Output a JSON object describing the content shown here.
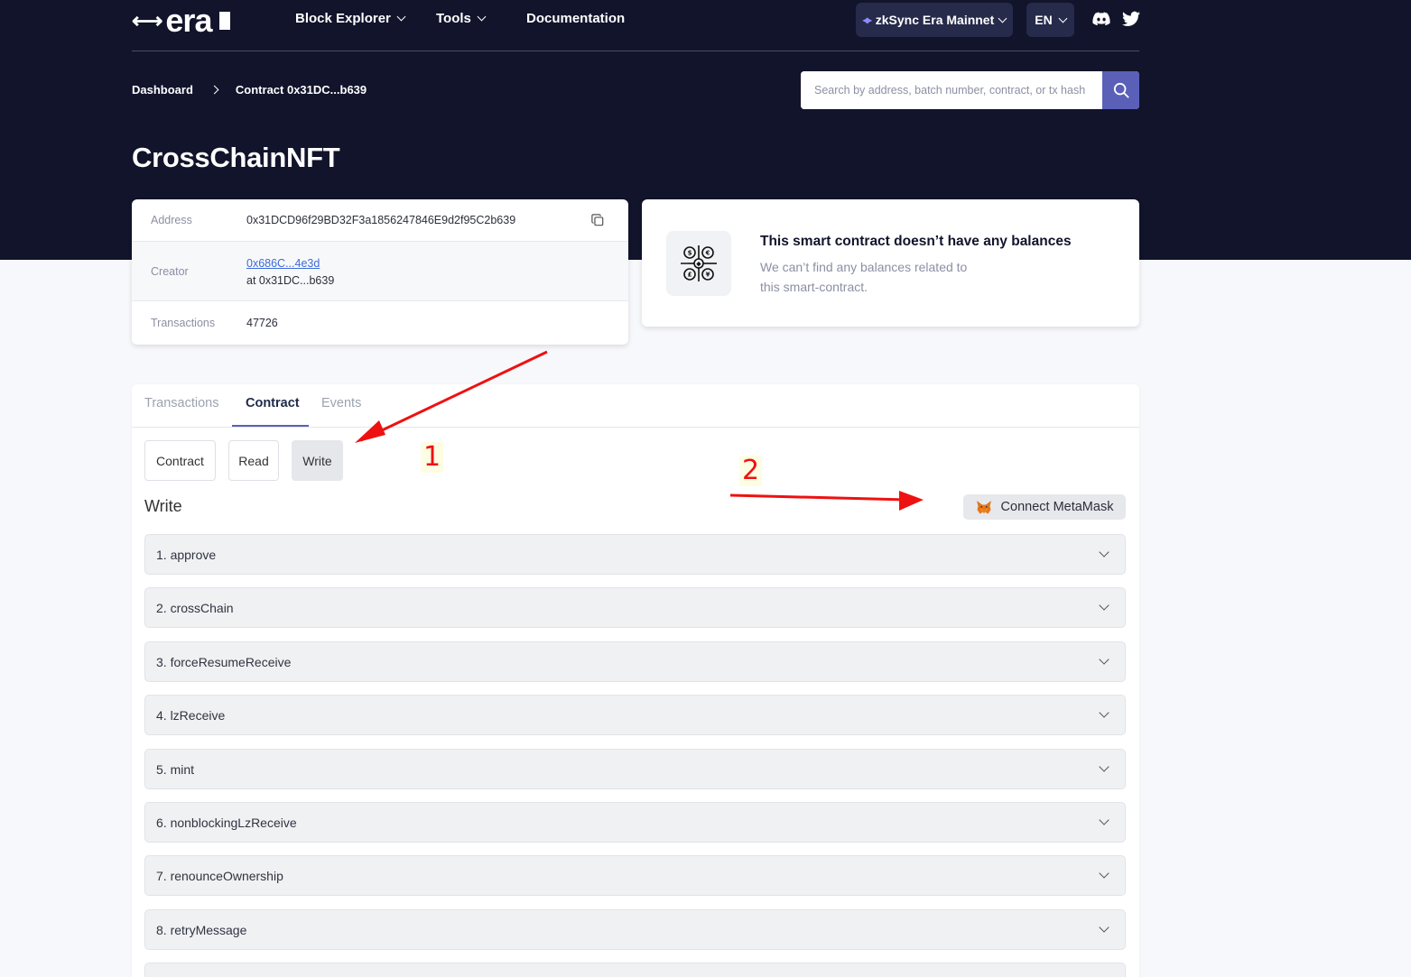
{
  "header": {
    "logo_text": "era",
    "nav": [
      {
        "label": "Block Explorer",
        "has_dropdown": true
      },
      {
        "label": "Tools",
        "has_dropdown": true
      },
      {
        "label": "Documentation",
        "has_dropdown": false
      }
    ],
    "network": "zkSync Era Mainnet",
    "language": "EN",
    "social": [
      "discord-icon",
      "twitter-icon"
    ]
  },
  "breadcrumb": {
    "items": [
      "Dashboard",
      "Contract 0x31DC...b639"
    ]
  },
  "search": {
    "placeholder": "Search by address, batch number, contract, or tx hash"
  },
  "page_title": "CrossChainNFT",
  "contract_info": {
    "address_label": "Address",
    "address_value": "0x31DCD96f29BD32F3a1856247846E9d2f95C2b639",
    "creator_label": "Creator",
    "creator_link": "0x686C...4e3d",
    "creator_at": "at 0x31DC...b639",
    "transactions_label": "Transactions",
    "transactions_value": "47726"
  },
  "balance": {
    "title": "This smart contract doesn’t have any balances",
    "description": "We can’t find any balances related to this smart-contract."
  },
  "tabs": [
    "Transactions",
    "Contract",
    "Events"
  ],
  "active_tab": "Contract",
  "subtabs": [
    "Contract",
    "Read",
    "Write"
  ],
  "active_subtab": "Write",
  "write_section": {
    "title": "Write",
    "connect_button": "Connect MetaMask",
    "functions": [
      "1. approve",
      "2. crossChain",
      "3. forceResumeReceive",
      "4. lzReceive",
      "5. mint",
      "6. nonblockingLzReceive",
      "7. renounceOwnership",
      "8. retryMessage"
    ]
  },
  "annotations": {
    "labels": [
      "1",
      "2"
    ],
    "color": "#ee1111"
  },
  "colors": {
    "header_bg": "#11142b",
    "accent": "#5a5fb8",
    "page_bg": "#f7f8fb"
  }
}
